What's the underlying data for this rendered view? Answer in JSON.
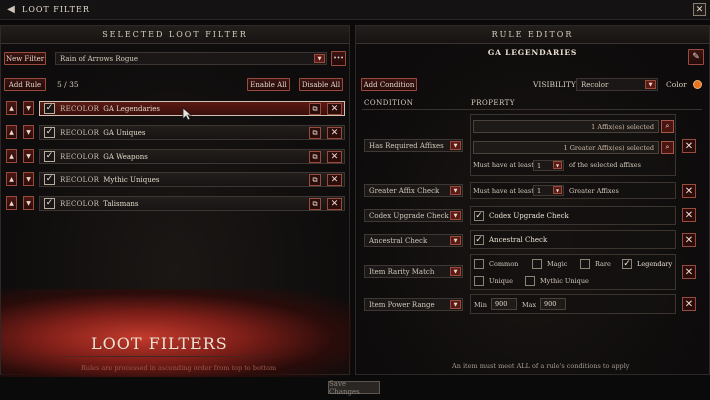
{
  "window": {
    "title": "LOOT FILTER",
    "close_glyph": "✕",
    "back_glyph": "◀"
  },
  "left": {
    "header": "SELECTED LOOT FILTER",
    "new_filter_label": "New Filter",
    "filter_name": "Rain of Arrows Rogue",
    "more_glyph": "•••",
    "add_rule_label": "Add Rule",
    "rule_count": "5 / 35",
    "enable_all_label": "Enable All",
    "disable_all_label": "Disable All",
    "rules": [
      {
        "type": "RECOLOR",
        "name": "GA Legendaries",
        "selected": true
      },
      {
        "type": "RECOLOR",
        "name": "GA Uniques",
        "selected": false
      },
      {
        "type": "RECOLOR",
        "name": "GA Weapons",
        "selected": false
      },
      {
        "type": "RECOLOR",
        "name": "Mythic Uniques",
        "selected": false
      },
      {
        "type": "RECOLOR",
        "name": "Talismans",
        "selected": false
      }
    ],
    "banner_title": "LOOT FILTERS",
    "banner_subtitle": "Rules are processed in ascending order from top to bottom"
  },
  "right": {
    "header": "RULE EDITOR",
    "rule_title": "GA LEGENDARIES",
    "add_condition_label": "Add Condition",
    "visibility_label": "VISIBILITY",
    "visibility_value": "Recolor",
    "color_label": "Color",
    "color_swatch": "#e8731f",
    "condition_header": "CONDITION",
    "property_header": "PROPERTY",
    "conditions": {
      "affixes": {
        "label": "Has Required Affixes",
        "affix_selected": "1 Affix(es) selected",
        "greater_selected": "1 Greater Affix(es) selected",
        "must_have": "Must have at least",
        "count": "1",
        "suffix": "of the selected affixes"
      },
      "greater": {
        "label": "Greater Affix Check",
        "must_have": "Must have at least",
        "count": "1",
        "suffix": "Greater Affixes"
      },
      "codex": {
        "label": "Codex Upgrade Check",
        "option": "Codex Upgrade Check",
        "checked": true
      },
      "ancestral": {
        "label": "Ancestral Check",
        "option": "Ancestral Check",
        "checked": true
      },
      "rarity": {
        "label": "Item Rarity Match",
        "options": [
          {
            "name": "Common",
            "checked": false
          },
          {
            "name": "Magic",
            "checked": false
          },
          {
            "name": "Rare",
            "checked": false
          },
          {
            "name": "Legendary",
            "checked": true
          },
          {
            "name": "Unique",
            "checked": false
          },
          {
            "name": "Mythic Unique",
            "checked": false
          }
        ]
      },
      "power": {
        "label": "Item Power Range",
        "min_label": "Min",
        "min": "900",
        "max_label": "Max",
        "max": "900"
      }
    },
    "footer_note": "An item must meet ALL of a rule's conditions to apply"
  },
  "save_label": "Save Changes",
  "icons": {
    "up": "▲",
    "down": "▼",
    "check": "✓",
    "copy": "⧉",
    "delete": "✕",
    "search": "⌕",
    "pencil": "✎"
  }
}
